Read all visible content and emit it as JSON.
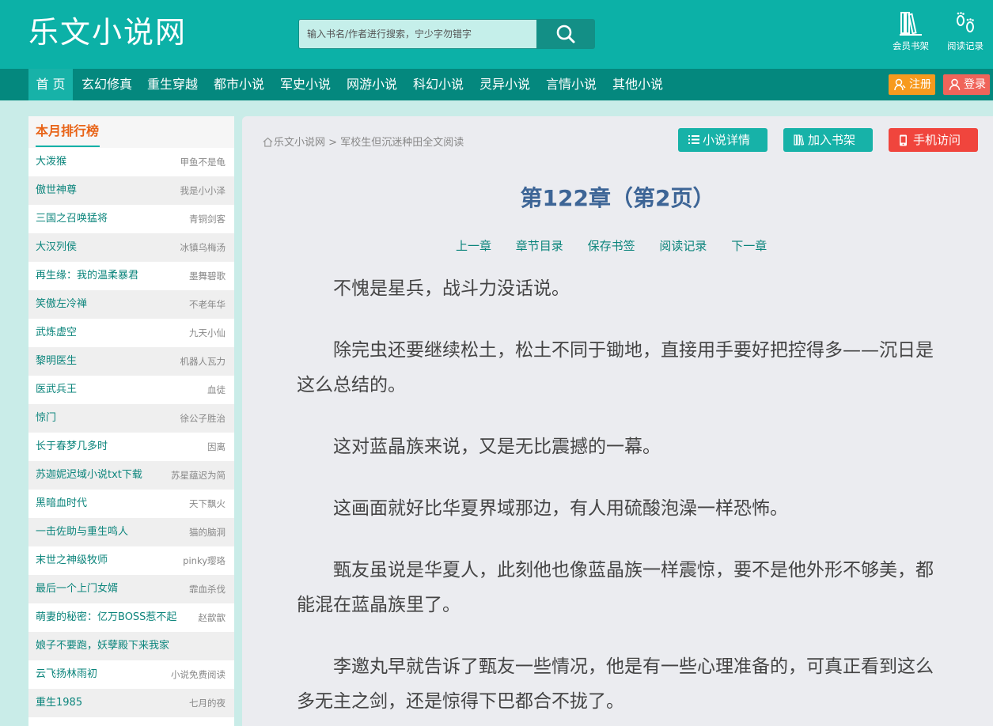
{
  "header": {
    "logo": "乐文小说网",
    "search_placeholder": "输入书名/作者进行搜索，宁少字勿错字",
    "bookshelf_label": "会员书架",
    "history_label": "阅读记录",
    "brand_color": "#0cb1a7"
  },
  "nav": {
    "items": [
      "首 页",
      "玄幻修真",
      "重生穿越",
      "都市小说",
      "军史小说",
      "网游小说",
      "科幻小说",
      "灵异小说",
      "言情小说",
      "其他小说"
    ],
    "register_label": "注册",
    "login_label": "登录"
  },
  "sidebar": {
    "title": "本月排行榜",
    "items": [
      {
        "book": "大泼猴",
        "author": "甲鱼不是龟"
      },
      {
        "book": "傲世神尊",
        "author": "我是小小泽"
      },
      {
        "book": "三国之召唤猛将",
        "author": "青铜剑客"
      },
      {
        "book": "大汉列侯",
        "author": "冰镇乌梅汤"
      },
      {
        "book": "再生缘：我的温柔暴君",
        "author": "墨舞碧歌"
      },
      {
        "book": "笑傲左冷禅",
        "author": "不老年华"
      },
      {
        "book": "武炼虚空",
        "author": "九天小仙"
      },
      {
        "book": "黎明医生",
        "author": "机器人瓦力"
      },
      {
        "book": "医武兵王",
        "author": "血徒"
      },
      {
        "book": "惊门",
        "author": "徐公子胜治"
      },
      {
        "book": "长于春梦几多时",
        "author": "因离"
      },
      {
        "book": "苏迦妮迟域小说txt下载",
        "author": "苏星蕴迟为简"
      },
      {
        "book": "黑暗血时代",
        "author": "天下飘火"
      },
      {
        "book": "一击佐助与重生鸣人",
        "author": "猫的脑洞"
      },
      {
        "book": "末世之神级牧师",
        "author": "pinky璎珞"
      },
      {
        "book": "最后一个上门女婿",
        "author": "霏血杀伐"
      },
      {
        "book": "萌妻的秘密：亿万BOSS惹不起",
        "author": "赵歆歆"
      },
      {
        "book": "娘子不要跑，妖孽殿下来我家",
        "author": ""
      },
      {
        "book": "云飞扬林雨初",
        "author": "小说免费阅读"
      },
      {
        "book": "重生1985",
        "author": "七月的夜"
      }
    ]
  },
  "main": {
    "breadcrumb_home": "乐文小说网",
    "breadcrumb_sep": ">",
    "breadcrumb_current": "军校生但沉迷种田全文阅读",
    "details_btn": "小说详情",
    "shelf_btn": "加入书架",
    "mobile_btn": "手机访问",
    "chapter_title": "第122章（第2页）",
    "chapter_nav": [
      "上一章",
      "章节目录",
      "保存书签",
      "阅读记录",
      "下一章"
    ],
    "paragraphs": [
      "不愧是星兵，战斗力没话说。",
      "除完虫还要继续松土，松土不同于锄地，直接用手要好把控得多——沉日是这么总结的。",
      "这对蓝晶族来说，又是无比震撼的一幕。",
      "这画面就好比华夏界域那边，有人用硫酸泡澡一样恐怖。",
      "甄友虽说是华夏人，此刻他也像蓝晶族一样震惊，要不是他外形不够美，都能混在蓝晶族里了。",
      "李邀丸早就告诉了甄友一些情况，他是有一些心理准备的，可真正看到这么多无主之剑，还是惊得下巴都合不拢了。"
    ]
  }
}
